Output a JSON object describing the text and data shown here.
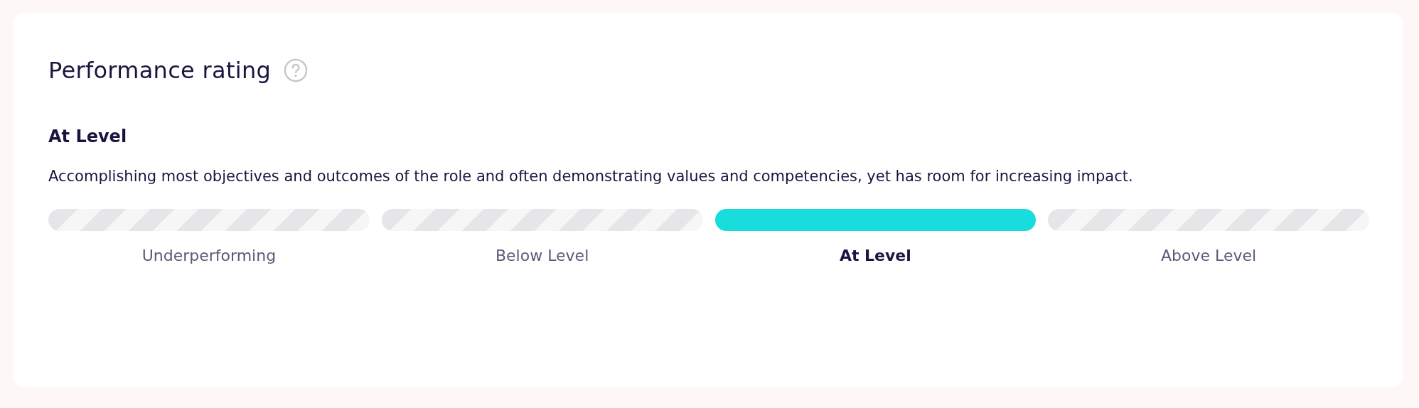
{
  "card": {
    "title": "Performance rating",
    "rating": {
      "name": "At Level",
      "description": "Accomplishing most objectives and outcomes of the role and often demonstrating values and competencies, yet has room for increasing impact."
    },
    "levels": [
      {
        "label": "Underperforming",
        "selected": false
      },
      {
        "label": "Below Level",
        "selected": false
      },
      {
        "label": "At Level",
        "selected": true
      },
      {
        "label": "Above Level",
        "selected": false
      }
    ]
  }
}
